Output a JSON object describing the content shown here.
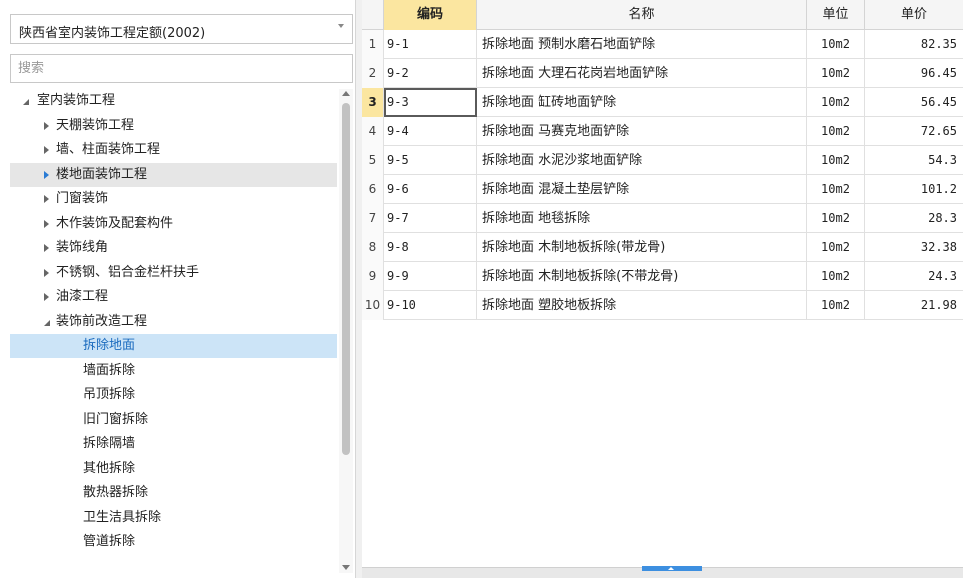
{
  "quota_select": {
    "value": "陕西省室内装饰工程定额(2002)"
  },
  "search": {
    "placeholder": "搜索",
    "value": ""
  },
  "tree": {
    "root": {
      "label": "室内装饰工程",
      "expanded": true
    },
    "items": [
      {
        "label": "天棚装饰工程",
        "expanded": false
      },
      {
        "label": "墙、柱面装饰工程",
        "expanded": false
      },
      {
        "label": "楼地面装饰工程",
        "expanded": false,
        "hover": true
      },
      {
        "label": "门窗装饰",
        "expanded": false
      },
      {
        "label": "木作装饰及配套构件",
        "expanded": false
      },
      {
        "label": "装饰线角",
        "expanded": false
      },
      {
        "label": "不锈钢、铝合金栏杆扶手",
        "expanded": false
      },
      {
        "label": "油漆工程",
        "expanded": false
      },
      {
        "label": "装饰前改造工程",
        "expanded": true
      }
    ],
    "children": [
      {
        "label": "拆除地面",
        "selected": true
      },
      {
        "label": "墙面拆除"
      },
      {
        "label": "吊顶拆除"
      },
      {
        "label": "旧门窗拆除"
      },
      {
        "label": "拆除隔墙"
      },
      {
        "label": "其他拆除"
      },
      {
        "label": "散热器拆除"
      },
      {
        "label": "卫生洁具拆除"
      },
      {
        "label": "管道拆除"
      }
    ]
  },
  "grid": {
    "columns": [
      "编码",
      "名称",
      "单位",
      "单价"
    ],
    "active_column": 0,
    "active_row": 2,
    "rows": [
      {
        "num": "1",
        "code": "9-1",
        "name": "拆除地面 预制水磨石地面铲除",
        "unit": "10m2",
        "price": "82.35"
      },
      {
        "num": "2",
        "code": "9-2",
        "name": "拆除地面 大理石花岗岩地面铲除",
        "unit": "10m2",
        "price": "96.45"
      },
      {
        "num": "3",
        "code": "9-3",
        "name": "拆除地面 缸砖地面铲除",
        "unit": "10m2",
        "price": "56.45"
      },
      {
        "num": "4",
        "code": "9-4",
        "name": "拆除地面 马赛克地面铲除",
        "unit": "10m2",
        "price": "72.65"
      },
      {
        "num": "5",
        "code": "9-5",
        "name": "拆除地面 水泥沙浆地面铲除",
        "unit": "10m2",
        "price": "54.3"
      },
      {
        "num": "6",
        "code": "9-6",
        "name": "拆除地面 混凝土垫层铲除",
        "unit": "10m2",
        "price": "101.2"
      },
      {
        "num": "7",
        "code": "9-7",
        "name": "拆除地面 地毯拆除",
        "unit": "10m2",
        "price": "28.3"
      },
      {
        "num": "8",
        "code": "9-8",
        "name": "拆除地面 木制地板拆除(带龙骨)",
        "unit": "10m2",
        "price": "32.38"
      },
      {
        "num": "9",
        "code": "9-9",
        "name": "拆除地面 木制地板拆除(不带龙骨)",
        "unit": "10m2",
        "price": "24.3"
      },
      {
        "num": "10",
        "code": "9-10",
        "name": "拆除地面 塑胶地板拆除",
        "unit": "10m2",
        "price": "21.98"
      }
    ]
  },
  "colors": {
    "selected_bg": "#cce4f7",
    "active_header": "#fbe6a0",
    "accent": "#3d8fe0"
  },
  "icons": [
    "dropdown-arrow-icon",
    "tree-expand-icon",
    "tree-collapse-icon",
    "scroll-up-icon",
    "scroll-down-icon",
    "splitter-arrow-icon"
  ]
}
